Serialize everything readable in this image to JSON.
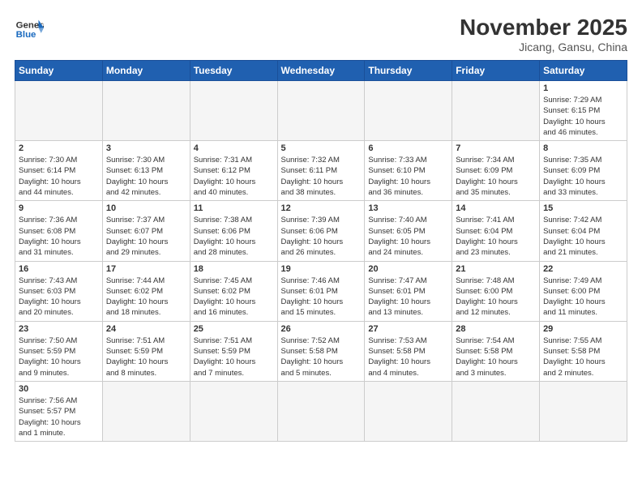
{
  "header": {
    "logo_general": "General",
    "logo_blue": "Blue",
    "month_year": "November 2025",
    "location": "Jicang, Gansu, China"
  },
  "weekdays": [
    "Sunday",
    "Monday",
    "Tuesday",
    "Wednesday",
    "Thursday",
    "Friday",
    "Saturday"
  ],
  "weeks": [
    [
      {
        "day": "",
        "info": ""
      },
      {
        "day": "",
        "info": ""
      },
      {
        "day": "",
        "info": ""
      },
      {
        "day": "",
        "info": ""
      },
      {
        "day": "",
        "info": ""
      },
      {
        "day": "",
        "info": ""
      },
      {
        "day": "1",
        "info": "Sunrise: 7:29 AM\nSunset: 6:15 PM\nDaylight: 10 hours\nand 46 minutes."
      }
    ],
    [
      {
        "day": "2",
        "info": "Sunrise: 7:30 AM\nSunset: 6:14 PM\nDaylight: 10 hours\nand 44 minutes."
      },
      {
        "day": "3",
        "info": "Sunrise: 7:30 AM\nSunset: 6:13 PM\nDaylight: 10 hours\nand 42 minutes."
      },
      {
        "day": "4",
        "info": "Sunrise: 7:31 AM\nSunset: 6:12 PM\nDaylight: 10 hours\nand 40 minutes."
      },
      {
        "day": "5",
        "info": "Sunrise: 7:32 AM\nSunset: 6:11 PM\nDaylight: 10 hours\nand 38 minutes."
      },
      {
        "day": "6",
        "info": "Sunrise: 7:33 AM\nSunset: 6:10 PM\nDaylight: 10 hours\nand 36 minutes."
      },
      {
        "day": "7",
        "info": "Sunrise: 7:34 AM\nSunset: 6:09 PM\nDaylight: 10 hours\nand 35 minutes."
      },
      {
        "day": "8",
        "info": "Sunrise: 7:35 AM\nSunset: 6:09 PM\nDaylight: 10 hours\nand 33 minutes."
      }
    ],
    [
      {
        "day": "9",
        "info": "Sunrise: 7:36 AM\nSunset: 6:08 PM\nDaylight: 10 hours\nand 31 minutes."
      },
      {
        "day": "10",
        "info": "Sunrise: 7:37 AM\nSunset: 6:07 PM\nDaylight: 10 hours\nand 29 minutes."
      },
      {
        "day": "11",
        "info": "Sunrise: 7:38 AM\nSunset: 6:06 PM\nDaylight: 10 hours\nand 28 minutes."
      },
      {
        "day": "12",
        "info": "Sunrise: 7:39 AM\nSunset: 6:06 PM\nDaylight: 10 hours\nand 26 minutes."
      },
      {
        "day": "13",
        "info": "Sunrise: 7:40 AM\nSunset: 6:05 PM\nDaylight: 10 hours\nand 24 minutes."
      },
      {
        "day": "14",
        "info": "Sunrise: 7:41 AM\nSunset: 6:04 PM\nDaylight: 10 hours\nand 23 minutes."
      },
      {
        "day": "15",
        "info": "Sunrise: 7:42 AM\nSunset: 6:04 PM\nDaylight: 10 hours\nand 21 minutes."
      }
    ],
    [
      {
        "day": "16",
        "info": "Sunrise: 7:43 AM\nSunset: 6:03 PM\nDaylight: 10 hours\nand 20 minutes."
      },
      {
        "day": "17",
        "info": "Sunrise: 7:44 AM\nSunset: 6:02 PM\nDaylight: 10 hours\nand 18 minutes."
      },
      {
        "day": "18",
        "info": "Sunrise: 7:45 AM\nSunset: 6:02 PM\nDaylight: 10 hours\nand 16 minutes."
      },
      {
        "day": "19",
        "info": "Sunrise: 7:46 AM\nSunset: 6:01 PM\nDaylight: 10 hours\nand 15 minutes."
      },
      {
        "day": "20",
        "info": "Sunrise: 7:47 AM\nSunset: 6:01 PM\nDaylight: 10 hours\nand 13 minutes."
      },
      {
        "day": "21",
        "info": "Sunrise: 7:48 AM\nSunset: 6:00 PM\nDaylight: 10 hours\nand 12 minutes."
      },
      {
        "day": "22",
        "info": "Sunrise: 7:49 AM\nSunset: 6:00 PM\nDaylight: 10 hours\nand 11 minutes."
      }
    ],
    [
      {
        "day": "23",
        "info": "Sunrise: 7:50 AM\nSunset: 5:59 PM\nDaylight: 10 hours\nand 9 minutes."
      },
      {
        "day": "24",
        "info": "Sunrise: 7:51 AM\nSunset: 5:59 PM\nDaylight: 10 hours\nand 8 minutes."
      },
      {
        "day": "25",
        "info": "Sunrise: 7:51 AM\nSunset: 5:59 PM\nDaylight: 10 hours\nand 7 minutes."
      },
      {
        "day": "26",
        "info": "Sunrise: 7:52 AM\nSunset: 5:58 PM\nDaylight: 10 hours\nand 5 minutes."
      },
      {
        "day": "27",
        "info": "Sunrise: 7:53 AM\nSunset: 5:58 PM\nDaylight: 10 hours\nand 4 minutes."
      },
      {
        "day": "28",
        "info": "Sunrise: 7:54 AM\nSunset: 5:58 PM\nDaylight: 10 hours\nand 3 minutes."
      },
      {
        "day": "29",
        "info": "Sunrise: 7:55 AM\nSunset: 5:58 PM\nDaylight: 10 hours\nand 2 minutes."
      }
    ],
    [
      {
        "day": "30",
        "info": "Sunrise: 7:56 AM\nSunset: 5:57 PM\nDaylight: 10 hours\nand 1 minute."
      },
      {
        "day": "",
        "info": ""
      },
      {
        "day": "",
        "info": ""
      },
      {
        "day": "",
        "info": ""
      },
      {
        "day": "",
        "info": ""
      },
      {
        "day": "",
        "info": ""
      },
      {
        "day": "",
        "info": ""
      }
    ]
  ]
}
